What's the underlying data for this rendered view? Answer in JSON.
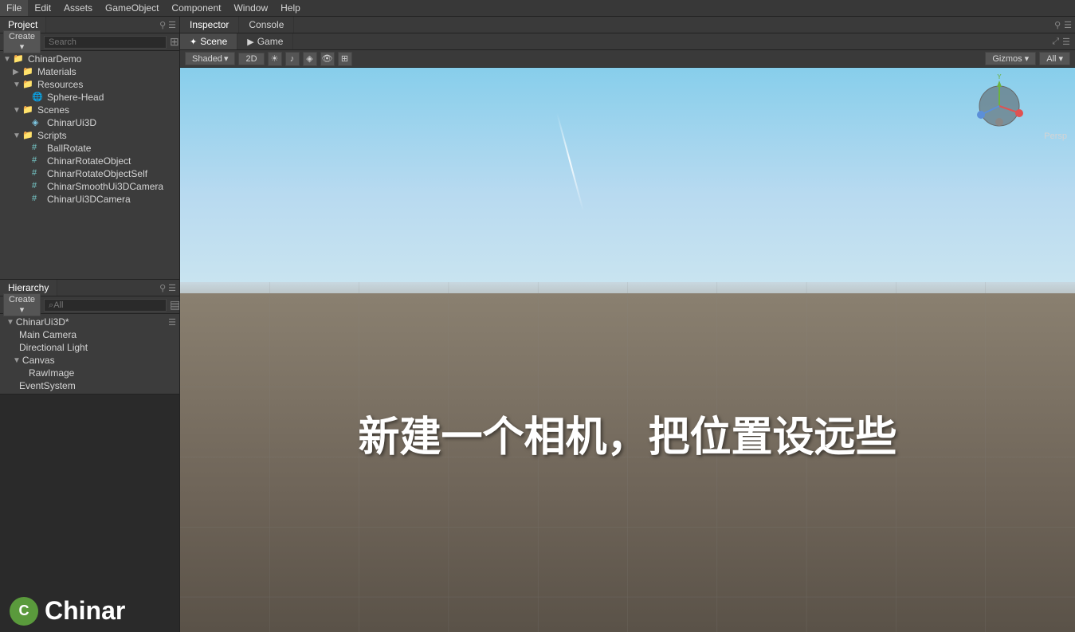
{
  "topMenu": {
    "items": [
      "File",
      "Edit",
      "Assets",
      "GameObject",
      "Component",
      "Window",
      "Help"
    ]
  },
  "projectPanel": {
    "tab": "Project",
    "createLabel": "Create ▾",
    "searchPlaceholder": "Search",
    "tree": [
      {
        "id": "ChinarDemo",
        "label": "ChinarDemo",
        "indent": 0,
        "type": "folder",
        "expanded": true
      },
      {
        "id": "Materials",
        "label": "Materials",
        "indent": 1,
        "type": "folder",
        "expanded": false
      },
      {
        "id": "Resources",
        "label": "Resources",
        "indent": 1,
        "type": "folder",
        "expanded": true
      },
      {
        "id": "Sphere-Head",
        "label": "Sphere-Head",
        "indent": 2,
        "type": "sphere"
      },
      {
        "id": "Scenes",
        "label": "Scenes",
        "indent": 1,
        "type": "folder",
        "expanded": true
      },
      {
        "id": "ChinarUi3D",
        "label": "ChinarUi3D",
        "indent": 2,
        "type": "scene"
      },
      {
        "id": "Scripts",
        "label": "Scripts",
        "indent": 1,
        "type": "folder",
        "expanded": true
      },
      {
        "id": "BallRotate",
        "label": "BallRotate",
        "indent": 2,
        "type": "script"
      },
      {
        "id": "ChinarRotateObject",
        "label": "ChinarRotateObject",
        "indent": 2,
        "type": "script"
      },
      {
        "id": "ChinarRotateObjectSelf",
        "label": "ChinarRotateObjectSelf",
        "indent": 2,
        "type": "script"
      },
      {
        "id": "ChinarSmoothUi3DCamera",
        "label": "ChinarSmoothUi3DCamera",
        "indent": 2,
        "type": "script"
      },
      {
        "id": "ChinarUi3DCamera",
        "label": "ChinarUi3DCamera",
        "indent": 2,
        "type": "script"
      }
    ]
  },
  "hierarchyPanel": {
    "tab": "Hierarchy",
    "createLabel": "Create ▾",
    "searchPlaceholder": "⌕All",
    "items": [
      {
        "id": "ChinarUi3D",
        "label": "ChinarUi3D*",
        "indent": 0,
        "expanded": true,
        "root": true
      },
      {
        "id": "MainCamera",
        "label": "Main Camera",
        "indent": 1
      },
      {
        "id": "DirectionalLight",
        "label": "Directional Light",
        "indent": 1
      },
      {
        "id": "Canvas",
        "label": "Canvas",
        "indent": 1,
        "expanded": true
      },
      {
        "id": "RawImage",
        "label": "RawImage",
        "indent": 2
      },
      {
        "id": "EventSystem",
        "label": "EventSystem",
        "indent": 1
      }
    ]
  },
  "inspectorPanel": {
    "tab1": "Inspector",
    "tab2": "Console"
  },
  "scenePanel": {
    "tab1": "Scene",
    "tab2": "Game",
    "toolbar": {
      "shaded": "Shaded",
      "2d": "2D",
      "gizmos": "Gizmos ▾",
      "allLabel": "All ▾"
    },
    "overlayText": "新建一个相机，把位置设远些",
    "perspLabel": "Persp"
  },
  "branding": {
    "name": "Chinar"
  }
}
